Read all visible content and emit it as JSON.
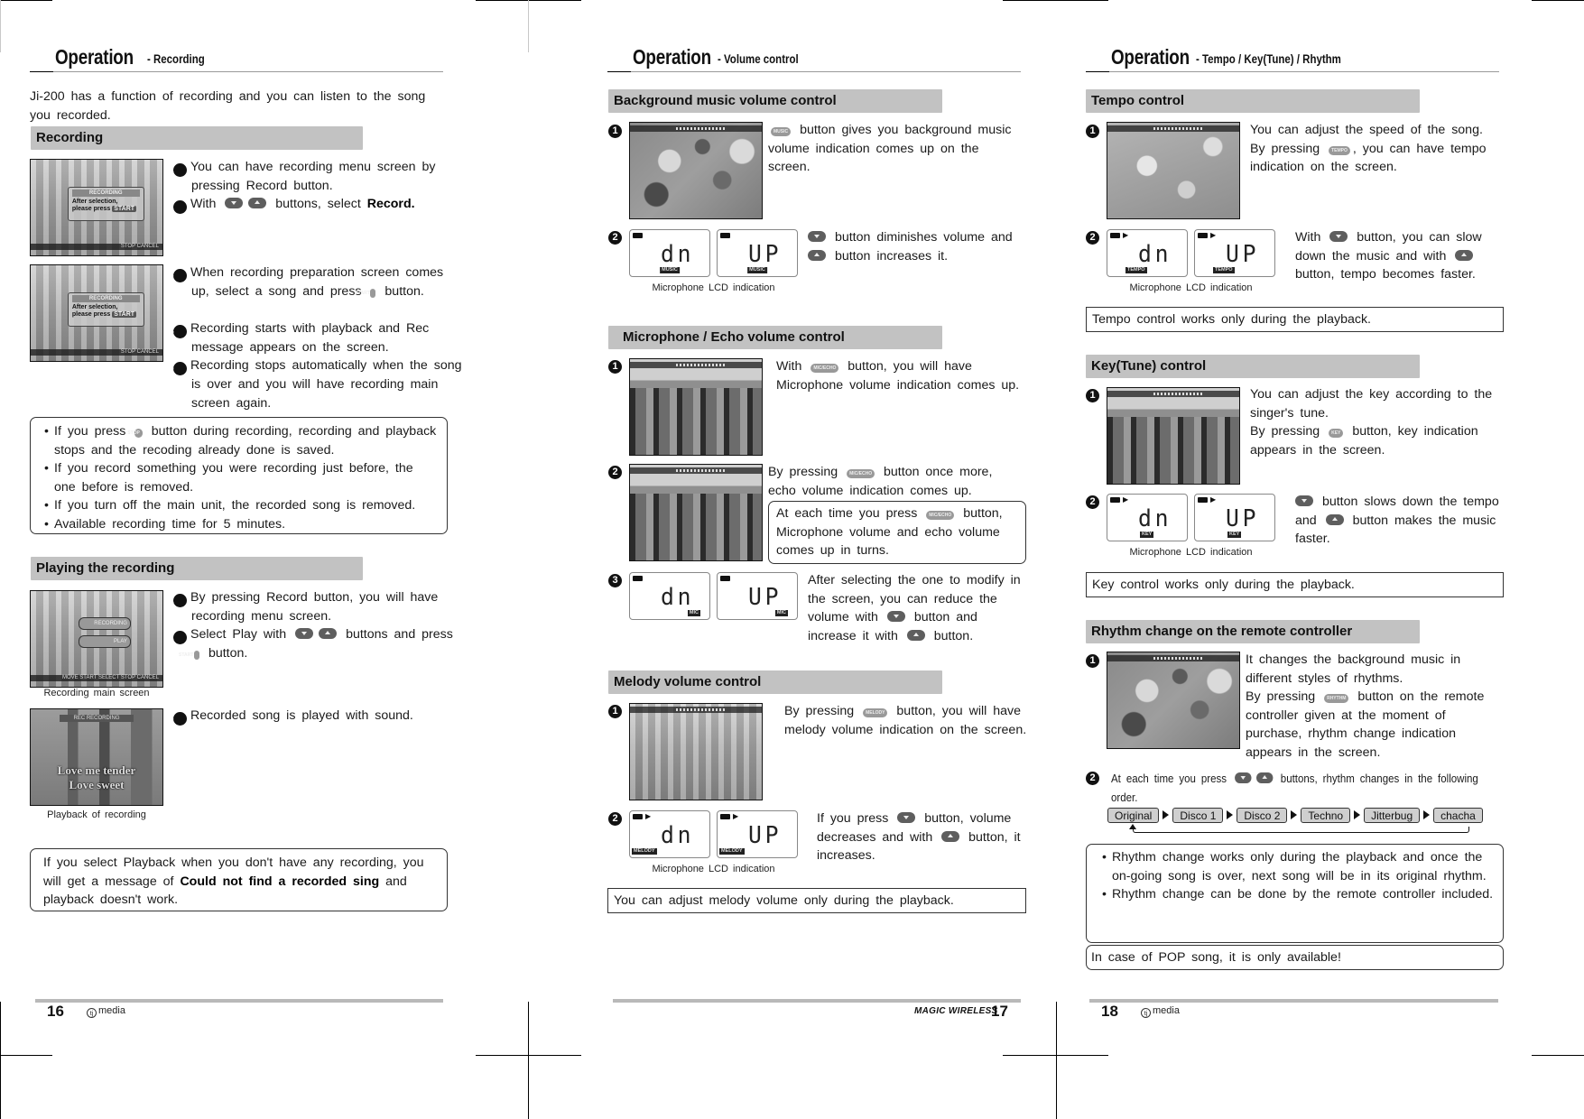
{
  "pages": [
    {
      "page_number": "16",
      "header": {
        "title": "Operation",
        "subtitle": "- Recording"
      },
      "intro": "Ji-200 has a function of recording and you can listen to the song you recorded.",
      "sections": [
        {
          "title": "Recording",
          "steps": [
            {
              "marker": "❶",
              "text": "You can have recording menu screen by pressing Record button."
            },
            {
              "marker": "❷",
              "text_before": "With",
              "buttons": [
                "down-button",
                "up-button"
              ],
              "text_after": "buttons, select",
              "emphasis": "Record."
            },
            {
              "marker": "❸",
              "text_before": "When recording preparation screen comes up, select a song and press",
              "button_label": "START",
              "text_after": "button."
            },
            {
              "marker": "❹",
              "text": "Recording starts with playback and Rec message appears on the screen."
            },
            {
              "marker": "❺",
              "text": "Recording stops automatically when the song is over and you will have recording main screen again."
            }
          ],
          "screens": [
            {
              "title": "RECORDING",
              "line1": "After selection,",
              "line2": "please press",
              "key": "START",
              "footer": "STOP CANCEL"
            },
            {
              "title": "RECORDING",
              "line1": "After selection,",
              "line2": "please press",
              "key": "START",
              "footer": "STOP CANCEL"
            }
          ],
          "notes": [
            {
              "before": "If you press",
              "button_label": "STOP",
              "after": "button during recording, recording and playback stops and the recoding already done is saved."
            },
            {
              "text": "If you record something you were recording just before, the one before is removed."
            },
            {
              "text": "If you turn off the main unit, the recorded song is removed."
            },
            {
              "text": "Available recording time for 5 minutes."
            }
          ]
        },
        {
          "title": "Playing the recording",
          "steps": [
            {
              "marker": "❶",
              "text": "By pressing Record button, you will have recording menu screen."
            },
            {
              "marker": "❷",
              "text_before": "Select Play with",
              "buttons": [
                "down-button",
                "up-button"
              ],
              "text_after": "buttons and press",
              "button_label": "START",
              "text_end": "button."
            },
            {
              "marker": "❸",
              "text": "Recorded song is played with sound."
            }
          ],
          "screens": [
            {
              "caption": "Recording main screen",
              "menu": [
                "RECORDING",
                "PLAY"
              ],
              "footer": "MOVE   START SELECT  STOP CANCEL"
            },
            {
              "caption": "Playback of recording",
              "banner": "REC  RECORDING",
              "lyric1": "Love me tender",
              "lyric2": "Love sweet"
            }
          ],
          "info_before": "If you select Playback when you don't have any recording, you will get a message of",
          "info_emphasis": "Could not find a recorded sing",
          "info_after": "and playback doesn't work."
        }
      ],
      "footer_brand": "media"
    },
    {
      "page_number": "17",
      "header": {
        "title": "Operation",
        "subtitle": "- Volume control"
      },
      "lcd_caption": "Microphone LCD indication",
      "lcd_values": {
        "down": "dn",
        "up": "UP"
      },
      "sections": [
        {
          "title": "Background music volume control",
          "step1": {
            "marker": "❶",
            "button_label": "MUSIC",
            "text": "button gives you background music volume indication comes up on the screen."
          },
          "step2": {
            "marker": "❷",
            "text1": "button diminishes volume and",
            "text2": "button increases it.",
            "lcd_mode": "MUSIC"
          }
        },
        {
          "title": "Microphone / Echo volume control",
          "step1": {
            "marker": "❶",
            "before": "With",
            "button_label": "MIC/ECHO",
            "after": "button, you will have Microphone volume indication comes up."
          },
          "step2": {
            "marker": "❷",
            "before": "By pressing",
            "button_label": "MIC/ECHO",
            "after": "button once more, echo volume indication comes up."
          },
          "step2_box": {
            "before": "At each time you press",
            "button_label": "MIC/ECHO",
            "after": "button, Microphone volume and echo volume comes up in turns."
          },
          "step3": {
            "marker": "❸",
            "text1": "After selecting the one to modify in the screen, you can reduce the volume with",
            "text2": "button and increase it with",
            "text3": "button.",
            "lcd_mode": "MIC"
          }
        },
        {
          "title": "Melody volume control",
          "step1": {
            "marker": "❶",
            "before": "By pressing",
            "button_label": "MELODY",
            "after": "button, you will have melody volume indication on the screen."
          },
          "step2": {
            "marker": "❷",
            "text1": "If you press",
            "text2": "button, volume decreases and with",
            "text3": "button, it increases.",
            "lcd_mode": "MELODY"
          },
          "note": "You can adjust melody volume only during the playback."
        }
      ],
      "footer_brand": "MAGIC WIRELESS"
    },
    {
      "page_number": "18",
      "header": {
        "title": "Operation",
        "subtitle": "- Tempo / Key(Tune) / Rhythm"
      },
      "lcd_caption": "Microphone LCD indication",
      "lcd_values": {
        "down": "dn",
        "up": "UP"
      },
      "sections": [
        {
          "title": "Tempo control",
          "step1": {
            "marker": "❶",
            "line1": "You can adjust the speed of the song.",
            "before": "By pressing",
            "button_label": "TEMPO",
            "after": ", you can have tempo indication on the screen."
          },
          "step2": {
            "marker": "❷",
            "text1": "With",
            "text2": "button, you can slow down the music and with",
            "text3": "button, tempo becomes faster.",
            "lcd_mode": "TEMPO"
          },
          "note": "Tempo control works only during the playback."
        },
        {
          "title": "Key(Tune) control",
          "step1": {
            "marker": "❶",
            "line1": "You can adjust the key according to the singer's tune.",
            "before": "By pressing",
            "button_label": "KEY",
            "after": "button, key indication appears in the screen."
          },
          "step2": {
            "marker": "❷",
            "text1": "button slows down the tempo and",
            "text2": "button makes the music faster.",
            "lcd_mode": "KEY"
          },
          "note": "Key control works only during the playback."
        },
        {
          "title": "Rhythm change on the remote controller",
          "step1": {
            "marker": "❶",
            "line1": "It changes the background music in different styles of rhythms.",
            "before": "By pressing",
            "button_label": "RHYTHM",
            "after": "button on the remote controller given at the moment of purchase, rhythm change indication appears in the screen."
          },
          "step2": {
            "marker": "❷",
            "before": "At each time you press",
            "after": "buttons, rhythm changes in the following order."
          },
          "rhythm_order": [
            "Original",
            "Disco 1",
            "Disco 2",
            "Techno",
            "Jitterbug",
            "chacha"
          ],
          "notes": [
            "Rhythm change works only during the playback and once the on-going song is over, next song will be in its original rhythm.",
            "Rhythm change can be done by the remote controller included."
          ],
          "pop_note": "In case of POP song, it is only available!"
        }
      ],
      "footer_brand": "media"
    }
  ]
}
